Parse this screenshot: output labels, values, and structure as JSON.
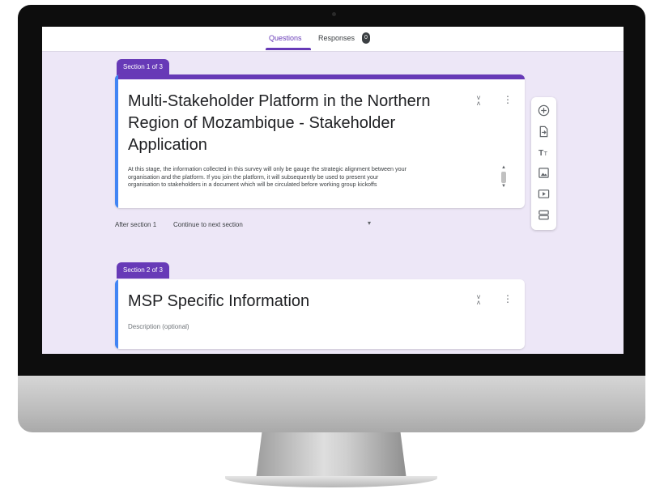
{
  "header": {
    "tabs": [
      {
        "label": "Questions",
        "active": true
      },
      {
        "label": "Responses",
        "badge": "0"
      }
    ]
  },
  "sections": [
    {
      "tab_label": "Section 1 of 3",
      "title": "Multi-Stakeholder Platform in the Northern Region of Mozambique - Stakeholder Application",
      "description_lines": [
        "At this stage, the information collected in this survey will only be gauge the strategic alignment between your",
        "organisation and the platform. If you join the platform, it will subsequently be used to present your",
        "organisation to stakeholders in a document which will be circulated before working group kickoffs"
      ]
    },
    {
      "tab_label": "Section 2 of 3",
      "title": "MSP Specific Information",
      "description_placeholder": "Description (optional)"
    }
  ],
  "after_section": {
    "label": "After section 1",
    "value": "Continue to next section"
  },
  "toolbar": {
    "icons": [
      "add-question-icon",
      "import-questions-icon",
      "add-title-icon",
      "add-image-icon",
      "add-video-icon",
      "add-section-icon"
    ]
  },
  "colors": {
    "accent": "#673ab7",
    "focus": "#4285f4",
    "background": "#ede7f7"
  }
}
